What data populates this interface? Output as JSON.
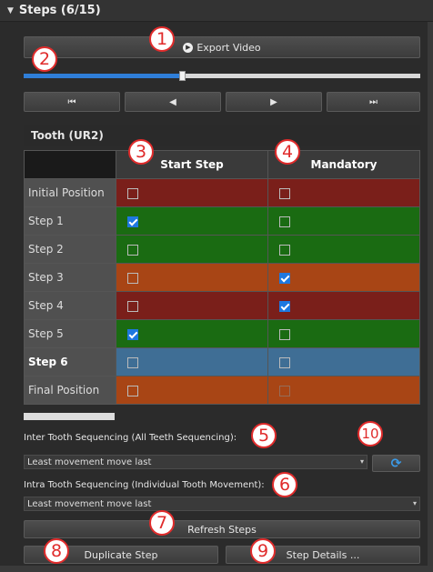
{
  "header": {
    "title": "Steps (6/15)",
    "collapse_glyph": "▼"
  },
  "toolbar": {
    "export_label": "Export Video",
    "export_icon_glyph": "▶"
  },
  "timeline": {
    "progress": 0.4,
    "current_step": 6,
    "total_steps": 15
  },
  "nav": {
    "first_glyph": "⏮",
    "prev_glyph": "◀",
    "next_glyph": "▶",
    "last_glyph": "⏭"
  },
  "section": {
    "title": "Tooth (UR2)"
  },
  "table": {
    "columns": [
      "Start Step",
      "Mandatory"
    ],
    "rows": [
      {
        "label": "Initial Position",
        "bold": false,
        "color": "#7a1f1a",
        "start": false,
        "mandatory": false,
        "mandatory_disabled": false
      },
      {
        "label": "Step 1",
        "bold": false,
        "color": "#1a6b12",
        "start": true,
        "mandatory": false,
        "mandatory_disabled": false
      },
      {
        "label": "Step 2",
        "bold": false,
        "color": "#1a6b12",
        "start": false,
        "mandatory": false,
        "mandatory_disabled": false
      },
      {
        "label": "Step 3",
        "bold": false,
        "color": "#a84515",
        "start": false,
        "mandatory": true,
        "mandatory_disabled": false
      },
      {
        "label": "Step 4",
        "bold": false,
        "color": "#7a1f1a",
        "start": false,
        "mandatory": true,
        "mandatory_disabled": false
      },
      {
        "label": "Step 5",
        "bold": false,
        "color": "#1a6b12",
        "start": true,
        "mandatory": false,
        "mandatory_disabled": false
      },
      {
        "label": "Step 6",
        "bold": true,
        "color": "#3f6e95",
        "start": false,
        "mandatory": false,
        "mandatory_disabled": false
      },
      {
        "label": "Final Position",
        "bold": false,
        "color": "#a84515",
        "start": false,
        "mandatory": false,
        "mandatory_disabled": true
      }
    ]
  },
  "inter": {
    "label": "Inter Tooth Sequencing (All Teeth Sequencing):",
    "value": "Least movement move last",
    "refresh_icon_glyph": "⟳"
  },
  "intra": {
    "label": "Intra Tooth Sequencing (Individual Tooth Movement):",
    "value": "Least movement move last"
  },
  "actions": {
    "refresh_label": "Refresh Steps",
    "duplicate_label": "Duplicate Step",
    "details_label": "Step Details ..."
  },
  "callouts": [
    "1",
    "2",
    "3",
    "4",
    "5",
    "6",
    "7",
    "8",
    "9",
    "10"
  ],
  "colors": {
    "accent": "#2f7ed8",
    "callout": "#e02b2b"
  }
}
